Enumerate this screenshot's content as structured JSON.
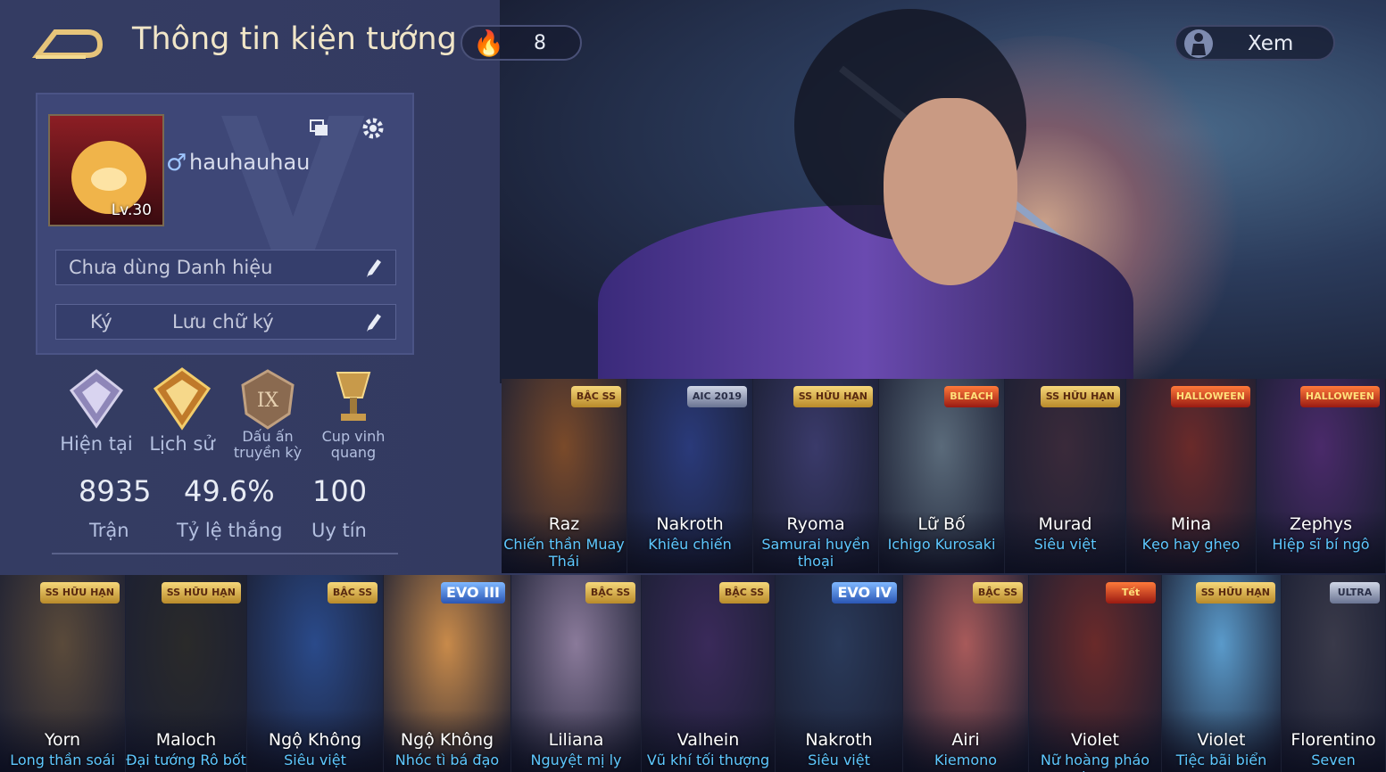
{
  "header": {
    "title": "Thông tin kiện tướng",
    "flame_count": "8",
    "view_button": "Xem"
  },
  "profile": {
    "username": "hauhauhau",
    "gender_symbol": "♂",
    "level": "Lv.30",
    "title_field": "Chưa dùng Danh hiệu",
    "signature_label": "Ký",
    "signature_field": "Lưu chữ ký"
  },
  "badges": [
    {
      "label": "Hiện tại",
      "icon": "rank-current-icon"
    },
    {
      "label": "Lịch sử",
      "icon": "rank-history-icon"
    },
    {
      "label": "Dấu ấn truyền kỳ",
      "icon": "legendary-mark-icon",
      "emblem": "IX"
    },
    {
      "label": "Cup vinh quang",
      "icon": "glory-cup-icon"
    }
  ],
  "stats": [
    {
      "value": "8935",
      "label": "Trận"
    },
    {
      "value": "49.6%",
      "label": "Tỷ lệ thắng"
    },
    {
      "value": "100",
      "label": "Uy tín"
    }
  ],
  "heroes_row1": [
    {
      "name": "Raz",
      "skin": "Chiến thần Muay Thái",
      "tag": "BẬC SS",
      "tag_style": "gold",
      "color": "#7a4a2a"
    },
    {
      "name": "Nakroth",
      "skin": "Khiêu chiến",
      "tag": "AIC 2019",
      "tag_style": "gray",
      "color": "#2a3a7a"
    },
    {
      "name": "Ryoma",
      "skin": "Samurai huyền thoại",
      "tag": "SS HỮU HẠN",
      "tag_style": "gold",
      "color": "#3a3a6a"
    },
    {
      "name": "Lữ Bố",
      "skin": "Ichigo Kurosaki",
      "tag": "BLEACH",
      "tag_style": "red",
      "color": "#5a6a7a"
    },
    {
      "name": "Murad",
      "skin": "Siêu việt",
      "tag": "SS HỮU HẠN",
      "tag_style": "gold",
      "color": "#3a2a3a"
    },
    {
      "name": "Mina",
      "skin": "Kẹo hay ghẹo",
      "tag": "HALLOWEEN",
      "tag_style": "red",
      "color": "#6a2a2a"
    },
    {
      "name": "Zephys",
      "skin": "Hiệp sĩ bí ngô",
      "tag": "HALLOWEEN",
      "tag_style": "red",
      "color": "#4a2a6a"
    }
  ],
  "heroes_row2": [
    {
      "name": "Yorn",
      "skin": "Long thần soái",
      "tag": "SS HỮU HẠN",
      "tag_style": "gold",
      "color": "#5a4a3a"
    },
    {
      "name": "Maloch",
      "skin": "Đại tướng Rô bốt",
      "tag": "SS HỮU HẠN",
      "tag_style": "gold",
      "color": "#2a2a2a"
    },
    {
      "name": "Ngộ Không",
      "skin": "Siêu việt",
      "tag": "BẬC SS",
      "tag_style": "gold",
      "color": "#2a4a8a"
    },
    {
      "name": "Ngộ Không",
      "skin": "Nhóc tì bá đạo",
      "tag": "EVO III",
      "tag_style": "evo",
      "color": "#c88a4a"
    },
    {
      "name": "Liliana",
      "skin": "Nguyệt mị ly",
      "tag": "BẬC SS",
      "tag_style": "gold",
      "color": "#8a7a9a"
    },
    {
      "name": "Valhein",
      "skin": "Vũ khí tối thượng",
      "tag": "BẬC SS",
      "tag_style": "gold",
      "color": "#3a2a5a"
    },
    {
      "name": "Nakroth",
      "skin": "Siêu việt",
      "tag": "EVO IV",
      "tag_style": "evo",
      "color": "#2a3a5a"
    },
    {
      "name": "Airi",
      "skin": "Kiemono",
      "tag": "BẬC SS",
      "tag_style": "gold",
      "color": "#a85a5a"
    },
    {
      "name": "Violet",
      "skin": "Nữ hoàng pháo hoa",
      "tag": "Tết",
      "tag_style": "red",
      "color": "#6a2a2a"
    },
    {
      "name": "Violet",
      "skin": "Tiệc bãi biển",
      "tag": "SS HỮU HẠN",
      "tag_style": "gold",
      "color": "#5a9aca"
    },
    {
      "name": "Florentino",
      "skin": "Seven",
      "tag": "ULTRA",
      "tag_style": "gray",
      "color": "#3a3a4a"
    }
  ]
}
